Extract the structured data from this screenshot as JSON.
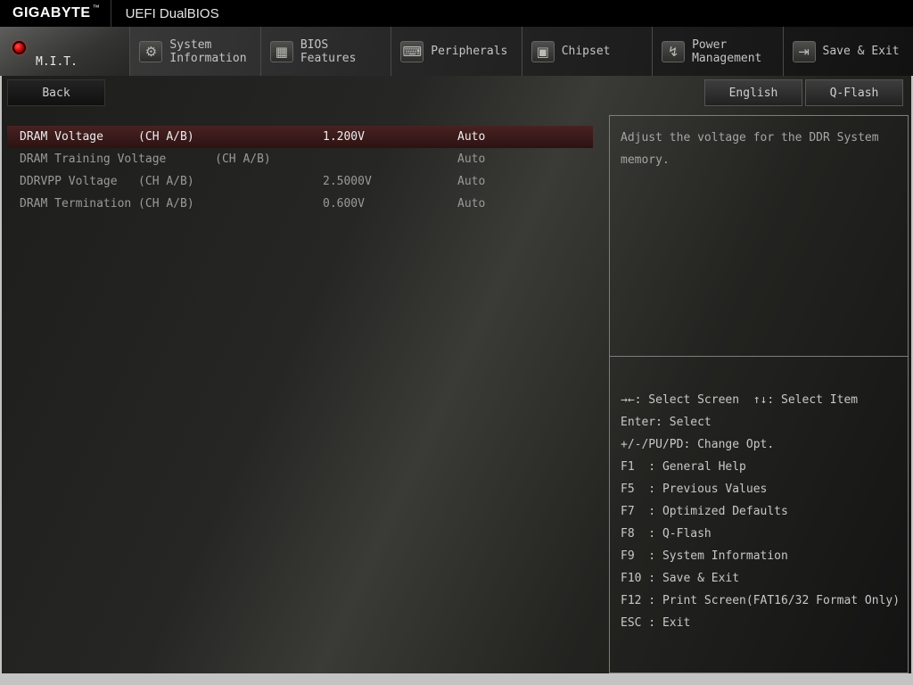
{
  "header": {
    "brand": "GIGABYTE",
    "brand_tm": "™",
    "title": "UEFI DualBIOS"
  },
  "tabs": [
    {
      "label": "M.I.T.",
      "selected": true
    },
    {
      "label": "System\nInformation",
      "glyph": "⚙"
    },
    {
      "label": "BIOS\nFeatures",
      "glyph": "▦"
    },
    {
      "label": "Peripherals",
      "glyph": "⌨"
    },
    {
      "label": "Chipset",
      "glyph": "▣"
    },
    {
      "label": "Power\nManagement",
      "glyph": "↯"
    },
    {
      "label": "Save & Exit",
      "glyph": "⇥"
    }
  ],
  "toolbar": {
    "back_label": "Back",
    "language_label": "English",
    "qflash_label": "Q-Flash"
  },
  "settings": [
    {
      "label": "DRAM Voltage     (CH A/B)",
      "value": "1.200V",
      "option": "Auto",
      "selected": true
    },
    {
      "label": "DRAM Training Voltage       (CH A/B)",
      "value": "",
      "option": "Auto"
    },
    {
      "label": "DDRVPP Voltage   (CH A/B)",
      "value": "2.5000V",
      "option": "Auto"
    },
    {
      "label": "DRAM Termination (CH A/B)",
      "value": "0.600V",
      "option": "Auto"
    }
  ],
  "help": {
    "text": "Adjust the voltage for the DDR System memory."
  },
  "shortcuts": [
    "→←: Select Screen  ↑↓: Select Item",
    "Enter: Select",
    "+/-/PU/PD: Change Opt.",
    "F1  : General Help",
    "F5  : Previous Values",
    "F7  : Optimized Defaults",
    "F8  : Q-Flash",
    "F9  : System Information",
    "F10 : Save & Exit",
    "F12 : Print Screen(FAT16/32 Format Only)",
    "ESC : Exit"
  ],
  "colors": {
    "accent_red": "#cc0000",
    "highlight_row": "#3a1c1c",
    "panel_border": "#7d7d7d"
  }
}
